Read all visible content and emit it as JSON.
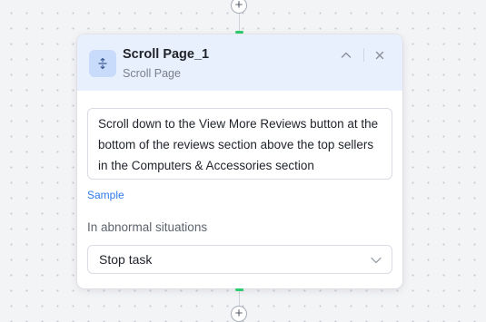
{
  "colors": {
    "header_background": "#e8f0fd",
    "icon_tile": "#c8dbfa",
    "port": "#2ecc71",
    "link": "#2f7bea"
  },
  "canvas": {
    "add_node_symbol": "+"
  },
  "node": {
    "title": "Scroll Page_1",
    "subtitle": "Scroll Page",
    "icon": "scroll-vertical-icon",
    "collapse_icon": "chevron-up-icon",
    "close_icon": "close-icon",
    "instruction": "Scroll down to the View More Reviews button at the bottom of the reviews section above the top sellers in the Computers & Accessories section",
    "sample_link": "Sample",
    "abnormal_label": "In abnormal situations",
    "abnormal_action": {
      "selected": "Stop task",
      "icon": "chevron-down-icon"
    }
  }
}
